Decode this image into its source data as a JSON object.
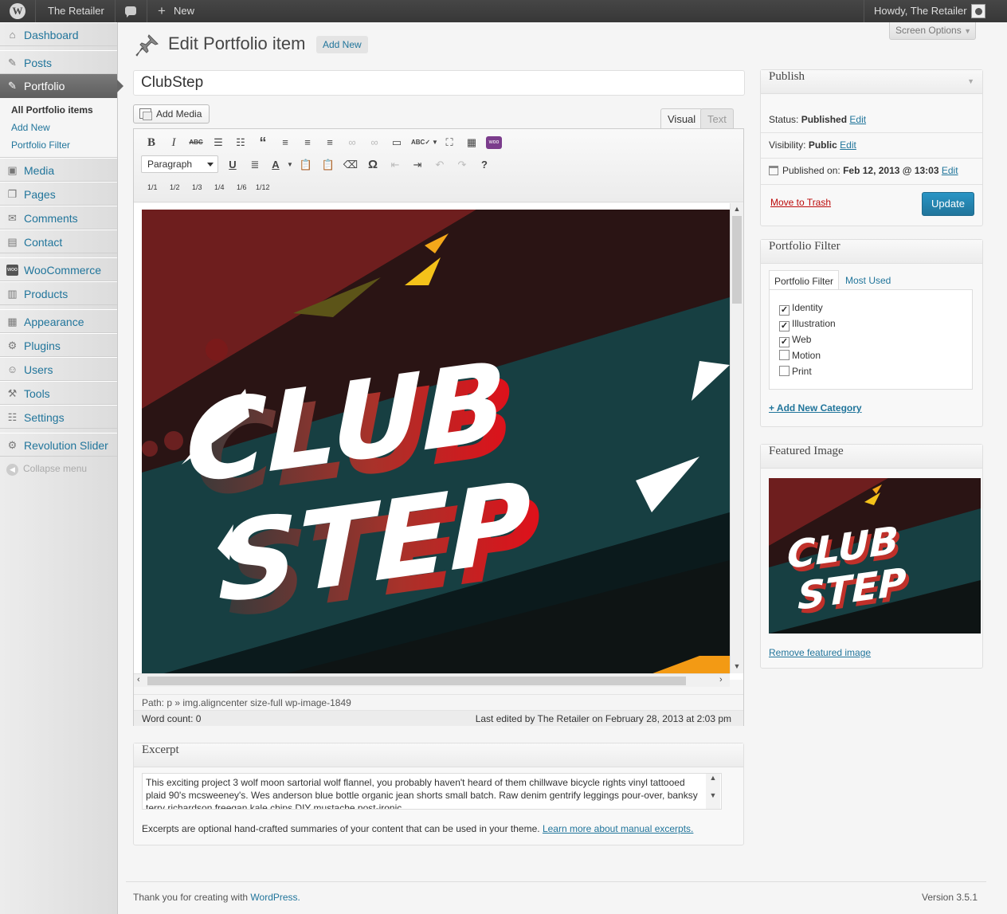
{
  "adminbar": {
    "site_name": "The Retailer",
    "new_label": "New",
    "greeting": "Howdy, The Retailer"
  },
  "sidebar": {
    "items": [
      {
        "label": "Dashboard",
        "icon": "dashboard-icon"
      },
      {
        "label": "Posts",
        "icon": "pin-icon"
      },
      {
        "label": "Portfolio",
        "icon": "pin-icon"
      },
      {
        "label": "Media",
        "icon": "media-icon"
      },
      {
        "label": "Pages",
        "icon": "pages-icon"
      },
      {
        "label": "Comments",
        "icon": "comment-icon"
      },
      {
        "label": "Contact",
        "icon": "contact-icon"
      },
      {
        "label": "WooCommerce",
        "icon": "woo-icon"
      },
      {
        "label": "Products",
        "icon": "products-icon"
      },
      {
        "label": "Appearance",
        "icon": "appearance-icon"
      },
      {
        "label": "Plugins",
        "icon": "plugin-icon"
      },
      {
        "label": "Users",
        "icon": "users-icon"
      },
      {
        "label": "Tools",
        "icon": "tools-icon"
      },
      {
        "label": "Settings",
        "icon": "settings-icon"
      },
      {
        "label": "Revolution Slider",
        "icon": "gear-icon"
      }
    ],
    "submenu": [
      "All Portfolio items",
      "Add New",
      "Portfolio Filter"
    ],
    "collapse_label": "Collapse menu"
  },
  "page": {
    "title": "Edit Portfolio item",
    "add_new": "Add New",
    "screen_options": "Screen Options"
  },
  "post": {
    "title": "ClubStep"
  },
  "editor": {
    "add_media": "Add Media",
    "tab_visual": "Visual",
    "tab_text": "Text",
    "format": "Paragraph",
    "columns": [
      "1/1",
      "1/2",
      "1/3",
      "1/4",
      "1/6",
      "1/12"
    ],
    "image_text_line1": "CLUB",
    "image_text_line2": "STEP",
    "path": "Path: p » img.aligncenter size-full wp-image-1849",
    "word_count": "Word count: 0",
    "last_edited": "Last edited by The Retailer on February 28, 2013 at 2:03 pm"
  },
  "excerpt": {
    "heading": "Excerpt",
    "text": "This exciting project 3 wolf moon sartorial wolf flannel, you probably haven't heard of them chillwave bicycle rights vinyl tattooed plaid 90's mcsweeney's. Wes anderson blue bottle organic jean shorts small batch. Raw denim gentrify leggings pour-over, banksy terry richardson freegan kale chips DIY mustache post-ironic.",
    "help": "Excerpts are optional hand-crafted summaries of your content that can be used in your theme.",
    "help_link": "Learn more about manual excerpts."
  },
  "publish": {
    "heading": "Publish",
    "status_label": "Status:",
    "status_value": "Published",
    "visibility_label": "Visibility:",
    "visibility_value": "Public",
    "published_label": "Published on:",
    "published_value": "Feb 12, 2013 @ 13:03",
    "edit": "Edit",
    "trash": "Move to Trash",
    "update": "Update"
  },
  "portfolio_filter": {
    "heading": "Portfolio Filter",
    "tab_all": "Portfolio Filter",
    "tab_most": "Most Used",
    "categories": [
      {
        "name": "Identity",
        "checked": true
      },
      {
        "name": "Illustration",
        "checked": true
      },
      {
        "name": "Web",
        "checked": true
      },
      {
        "name": "Motion",
        "checked": false
      },
      {
        "name": "Print",
        "checked": false
      }
    ],
    "add_new": "+ Add New Category"
  },
  "featured": {
    "heading": "Featured Image",
    "remove": "Remove featured image"
  },
  "footer": {
    "thanks": "Thank you for creating with",
    "wordpress": "WordPress.",
    "version": "Version 3.5.1"
  },
  "colors": {
    "link": "#21759b",
    "update_button": "#21759b",
    "trash": "#bc0b0b"
  }
}
